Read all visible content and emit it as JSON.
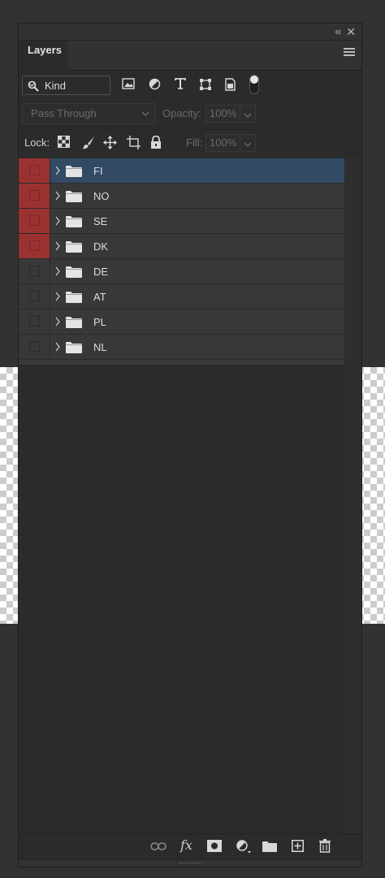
{
  "panel": {
    "tab_label": "Layers",
    "collapse_glyph": "‹‹",
    "close_glyph": "✕"
  },
  "filter": {
    "kind_label": "Kind",
    "icons": [
      "image-filter-icon",
      "adjustment-filter-icon",
      "type-filter-icon",
      "shape-filter-icon",
      "smart-object-filter-icon"
    ]
  },
  "blend": {
    "mode": "Pass Through",
    "opacity_label": "Opacity:",
    "opacity_value": "100%"
  },
  "lock": {
    "label": "Lock:",
    "fill_label": "Fill:",
    "fill_value": "100%"
  },
  "layers": [
    {
      "name": "FI",
      "selected": true,
      "color": "red"
    },
    {
      "name": "NO",
      "selected": false,
      "color": "red"
    },
    {
      "name": "SE",
      "selected": false,
      "color": "red"
    },
    {
      "name": "DK",
      "selected": false,
      "color": "red"
    },
    {
      "name": "DE",
      "selected": false,
      "color": "none"
    },
    {
      "name": "AT",
      "selected": false,
      "color": "none"
    },
    {
      "name": "PL",
      "selected": false,
      "color": "none"
    },
    {
      "name": "NL",
      "selected": false,
      "color": "none"
    }
  ],
  "bottom": {
    "fx_label": "fx"
  },
  "colors": {
    "selection": "#324a64",
    "color_tag_red": "#9b3232",
    "panel_bg": "#2b2b2b"
  }
}
